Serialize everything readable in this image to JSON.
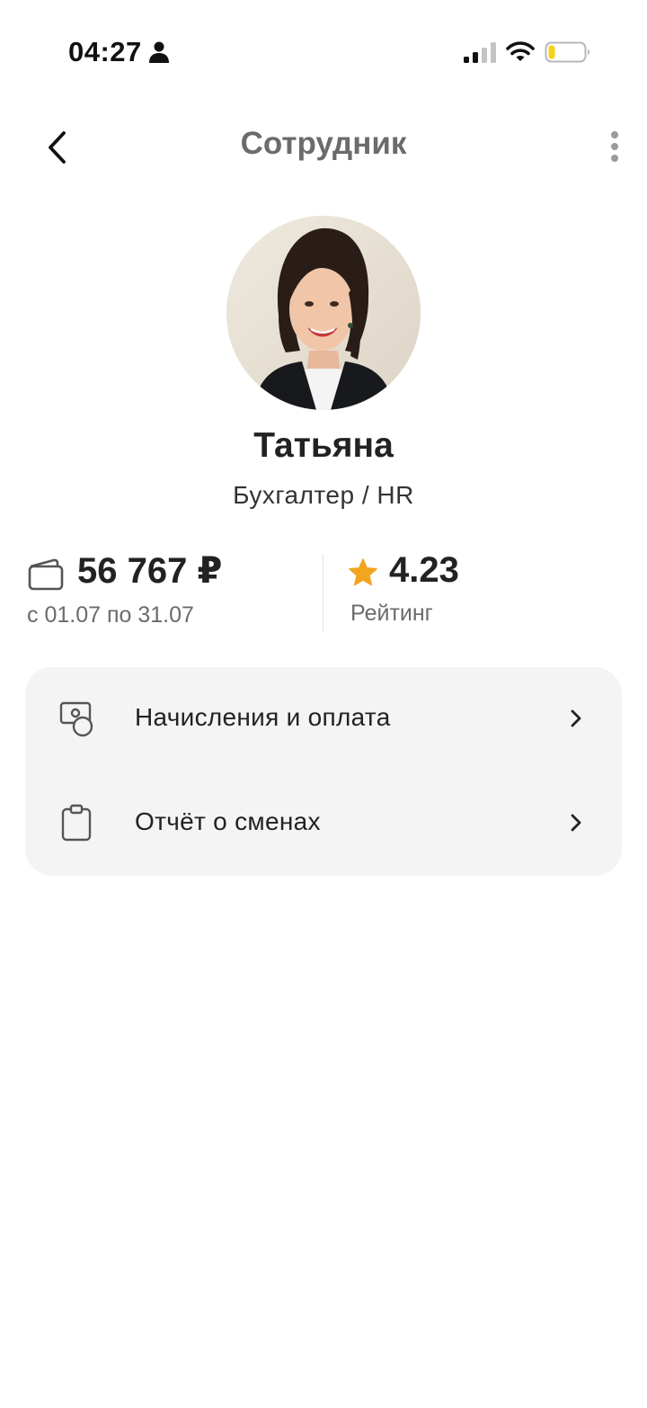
{
  "status_bar": {
    "time": "04:27",
    "icons": [
      "person-icon",
      "cellular-signal-icon",
      "wifi-icon",
      "battery-low-icon"
    ]
  },
  "header": {
    "title": "Сотрудник",
    "back_icon": "chevron-left-icon",
    "more_icon": "more-vertical-icon"
  },
  "profile": {
    "name": "Татьяна",
    "role": "Бухгалтер / HR",
    "avatar": "employee-photo"
  },
  "stats": {
    "salary": {
      "icon": "wallet-icon",
      "amount": "56 767 ₽",
      "period": "с 01.07 по 31.07"
    },
    "rating": {
      "icon": "star-icon",
      "value": "4.23",
      "label": "Рейтинг"
    }
  },
  "menu": {
    "items": [
      {
        "label": "Начисления и оплата",
        "icon": "money-coin-icon"
      },
      {
        "label": "Отчёт о сменах",
        "icon": "clipboard-icon"
      }
    ]
  },
  "colors": {
    "accent_star": "#F2A61E",
    "battery_low": "#F5D11B",
    "card_background": "#F4F4F4",
    "title_gray": "#6B6B6B"
  }
}
